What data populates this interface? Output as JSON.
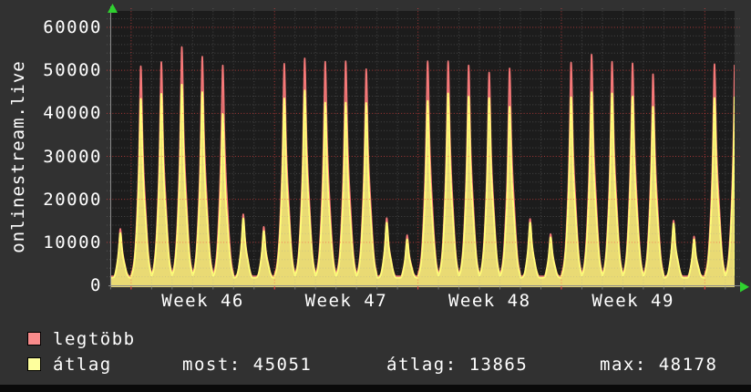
{
  "title": "onlinestream.live",
  "chart_data": {
    "type": "area",
    "title": "onlinestream.live",
    "ylim": [
      0,
      63800
    ],
    "y_ticks": [
      0,
      10000,
      20000,
      30000,
      40000,
      50000,
      60000
    ],
    "x_tick_labels": [
      "Week 46",
      "Week 47",
      "Week 48",
      "Week 49"
    ],
    "grid": "dotted; gray minor every 2000 (y) / 1 day (x), red major every 10000 (y) / 1 week (x)",
    "legend_position": "bottom-left",
    "days_span": 31,
    "series": [
      {
        "name": "legtöbb",
        "stroke": "#f67878",
        "fill": "rgba(238,114,114,0.80)",
        "daily_peaks": [
          13500,
          52400,
          53400,
          57000,
          54700,
          52600,
          17000,
          14000,
          53000,
          54300,
          53500,
          53600,
          51700,
          16100,
          12000,
          53600,
          53600,
          52600,
          50900,
          51900,
          15900,
          12300,
          53300,
          55200,
          53500,
          53100,
          50500,
          15500,
          11700,
          52900,
          52600
        ]
      },
      {
        "name": "átlag",
        "stroke": "#ffff78",
        "fill": "rgba(240,240,120,0.85)",
        "daily_peaks": [
          12500,
          44600,
          45800,
          48000,
          46200,
          41000,
          16000,
          13000,
          44700,
          46600,
          43700,
          43700,
          43600,
          15000,
          11000,
          44100,
          45900,
          45200,
          44800,
          42700,
          15000,
          11500,
          45000,
          46200,
          45900,
          45200,
          42700,
          14800,
          11000,
          44800,
          45000
        ]
      }
    ],
    "value_floors": [
      2100,
      1750
    ],
    "day_profile": [
      [
        0,
        0.05
      ],
      [
        0.1,
        0.075
      ],
      [
        0.2,
        0.16
      ],
      [
        0.3,
        0.34
      ],
      [
        0.38,
        0.56
      ],
      [
        0.44,
        0.88
      ],
      [
        0.47,
        1.0
      ],
      [
        0.51,
        0.9
      ],
      [
        0.56,
        0.63
      ],
      [
        0.63,
        0.47
      ],
      [
        0.7,
        0.36
      ],
      [
        0.78,
        0.22
      ],
      [
        0.88,
        0.1
      ],
      [
        1,
        0.05
      ]
    ]
  },
  "legend": [
    {
      "label": "legtöbb",
      "swatch": "#f98b8b"
    },
    {
      "label": "átlag",
      "swatch": "#feff9d"
    }
  ],
  "stats": [
    {
      "label": "most",
      "value": "45051"
    },
    {
      "label": "átlag",
      "value": "13865"
    },
    {
      "label": "max",
      "value": "48178"
    }
  ],
  "colors": {
    "page_bg": "#313131",
    "plot_bg": "#1c1c1c",
    "minor_grid": "#9a9a9a",
    "major_grid": "#ff4646",
    "axis": "#8a8a8a",
    "arrow": "#2fd12f",
    "text": "#ffffff"
  }
}
